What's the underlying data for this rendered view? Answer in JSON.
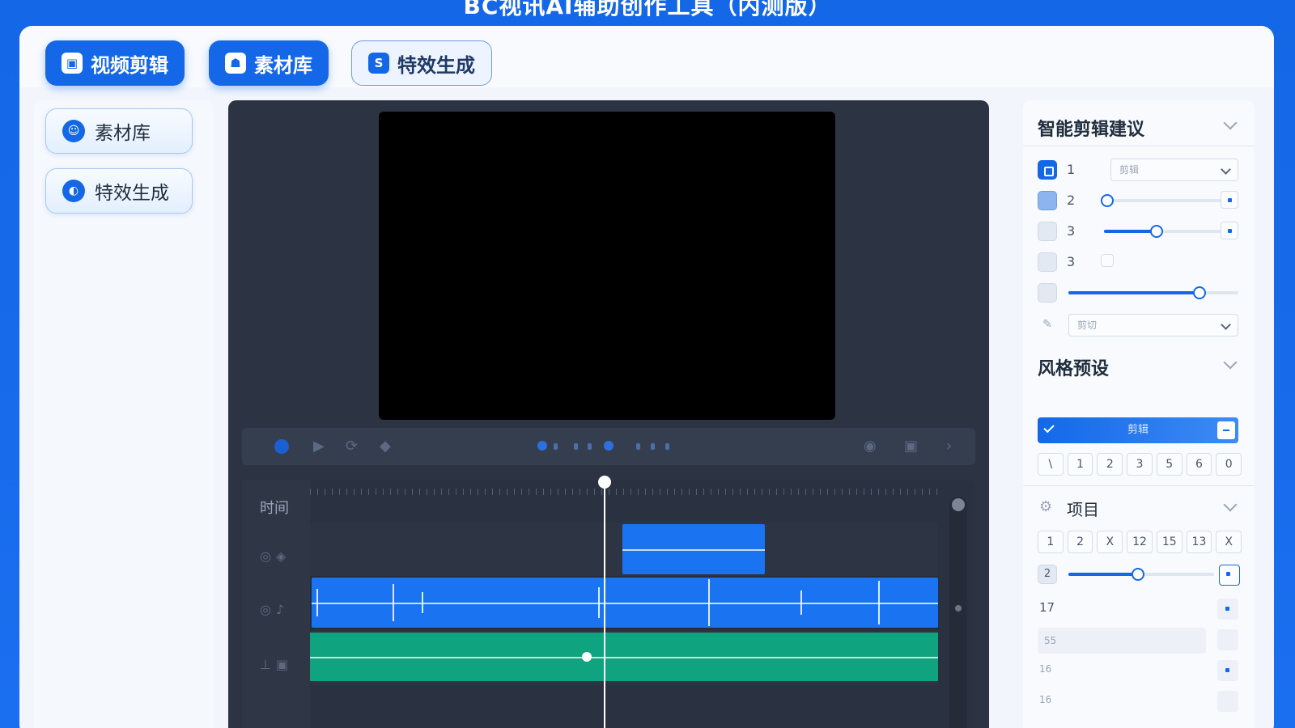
{
  "app": {
    "title": "BC视讯AI辅助创作工具（内测版）"
  },
  "top_tabs": [
    {
      "label": "视频剪辑",
      "icon": "video-edit-icon"
    },
    {
      "label": "素材库",
      "icon": "library-icon"
    },
    {
      "label": "特效生成",
      "icon": "effects-icon"
    }
  ],
  "sidebar": {
    "items": [
      {
        "label": "素材库",
        "icon": "library-icon"
      },
      {
        "label": "特效生成",
        "icon": "effects-icon"
      }
    ]
  },
  "timeline": {
    "time_label": "时间",
    "playhead_fraction": 0.47
  },
  "right_panel": {
    "suggest": {
      "title": "智能剪辑建议",
      "rows": [
        {
          "num": "1",
          "select_value": "剪辑"
        },
        {
          "num": "2",
          "slider": 0.03
        },
        {
          "num": "3",
          "slider": 0.45
        },
        {
          "num": "3"
        },
        {
          "slider": 0.77
        },
        {
          "select_value": "剪切"
        }
      ]
    },
    "style": {
      "title": "风格预设",
      "selected": "剪辑",
      "chips": [
        "\\",
        "1",
        "2",
        "3",
        "5",
        "6",
        "0"
      ]
    },
    "project": {
      "title": "项目",
      "chips": [
        "1",
        "2",
        "X",
        "12",
        "15",
        "13",
        "X"
      ],
      "slider": 0.48,
      "slider_label": "2",
      "count": "17",
      "rows": [
        "55",
        "16",
        "16"
      ]
    }
  },
  "colors": {
    "accent": "#1468e8",
    "editor_bg": "#2c3444",
    "audio_clip": "#1a73f0",
    "music_clip": "#10a37f"
  }
}
